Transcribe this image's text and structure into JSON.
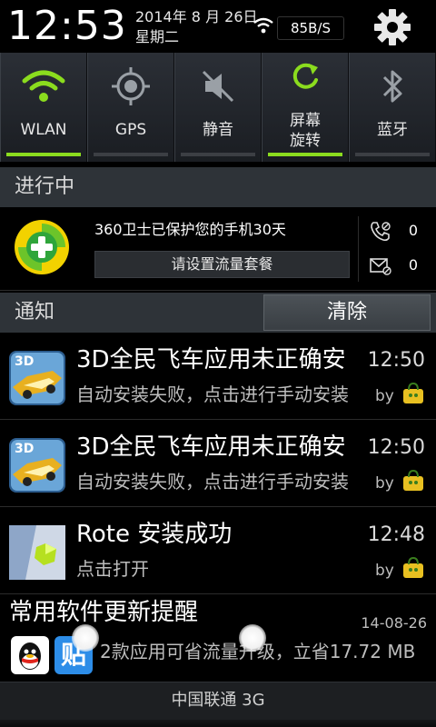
{
  "status": {
    "time": "12:53",
    "date": "2014年 8 月 26日",
    "weekday": "星期二",
    "net_speed": "85B/S",
    "wifi_icon": "wifi-icon",
    "settings_icon": "gear-icon"
  },
  "toggles": [
    {
      "label": "WLAN",
      "icon": "wifi-icon",
      "active": true
    },
    {
      "label": "GPS",
      "icon": "gps-icon",
      "active": false
    },
    {
      "label": "静音",
      "icon": "mute-icon",
      "active": false
    },
    {
      "label": "屏幕\n旋转",
      "label_line1": "屏幕",
      "label_line2": "旋转",
      "icon": "rotate-icon",
      "active": true
    },
    {
      "label": "蓝牙",
      "icon": "bluetooth-icon",
      "active": false
    }
  ],
  "ongoing": {
    "header": "进行中",
    "app": {
      "text": "360卫士已保护您的手机30天",
      "button": "请设置流量套餐",
      "calls_blocked": "0",
      "sms_blocked": "0"
    }
  },
  "notifications": {
    "header": "通知",
    "clear_label": "清除",
    "items": [
      {
        "title": "3D全民飞车应用未正确安",
        "subtitle": "自动安装失败，点击进行手动安装",
        "time": "12:50",
        "by": "by",
        "icon": "racing-game-icon"
      },
      {
        "title": "3D全民飞车应用未正确安",
        "subtitle": "自动安装失败，点击进行手动安装",
        "time": "12:50",
        "by": "by",
        "icon": "racing-game-icon"
      },
      {
        "title": "Rote 安装成功",
        "subtitle": "点击打开",
        "time": "12:48",
        "by": "by",
        "icon": "rote-app-icon"
      }
    ],
    "update": {
      "title": "常用软件更新提醒",
      "date": "14-08-26",
      "desc": "2款应用可省流量升级，立省17.72 MB",
      "app1_icon": "qq-icon",
      "app2_icon": "tieba-icon",
      "app2_glyph": "贴"
    }
  },
  "footer": {
    "carrier": "中国联通 3G"
  },
  "colors": {
    "accent_green": "#8bdc1e",
    "panel_dark": "#2e3338"
  }
}
